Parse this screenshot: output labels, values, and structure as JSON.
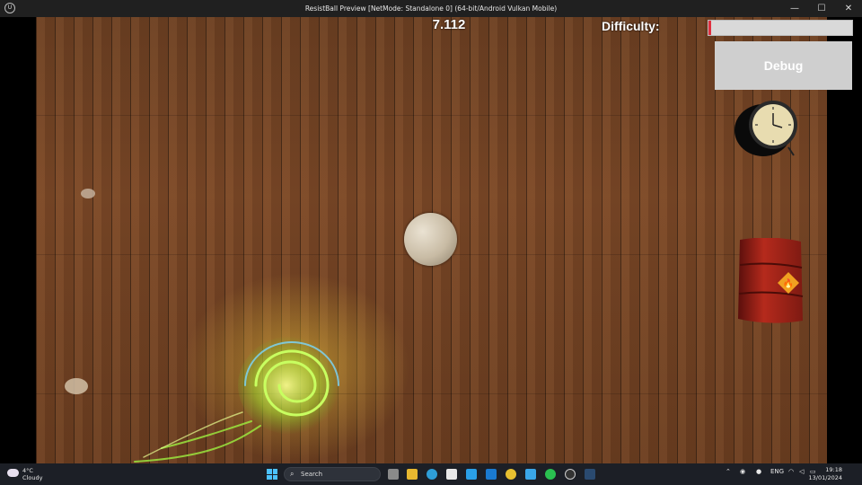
{
  "window": {
    "title": "ResistBall Preview [NetMode: Standalone 0]  (64-bit/Android Vulkan Mobile)",
    "app_icon": "unreal-engine-icon",
    "minimize_glyph": "—",
    "maximize_glyph": "☐",
    "close_glyph": "✕"
  },
  "hud": {
    "timer": "7.112",
    "difficulty_label": "Difficulty:",
    "difficulty_level": 0.02,
    "difficulty_bar_color": "#e03040",
    "debug_label": "Debug"
  },
  "scene": {
    "objects": [
      "ball",
      "clock",
      "oil-barrel",
      "green-vortex",
      "rock",
      "rock"
    ]
  },
  "taskbar": {
    "weather_temp": "4°C",
    "weather_condition": "Cloudy",
    "search_placeholder": "Search",
    "language": "ENG",
    "time": "19:18",
    "date": "13/01/2024",
    "pinned_apps": [
      "task-view-icon",
      "file-explorer-icon",
      "edge-icon",
      "store-icon",
      "vscode-icon",
      "outlook-icon",
      "chrome-icon",
      "notepad-icon",
      "whatsapp-icon",
      "unreal-engine-icon",
      "steam-icon"
    ],
    "tray_icons": [
      "chevron-up-icon",
      "steam-tray-icon",
      "wifi-icon",
      "volume-icon",
      "battery-icon"
    ]
  }
}
